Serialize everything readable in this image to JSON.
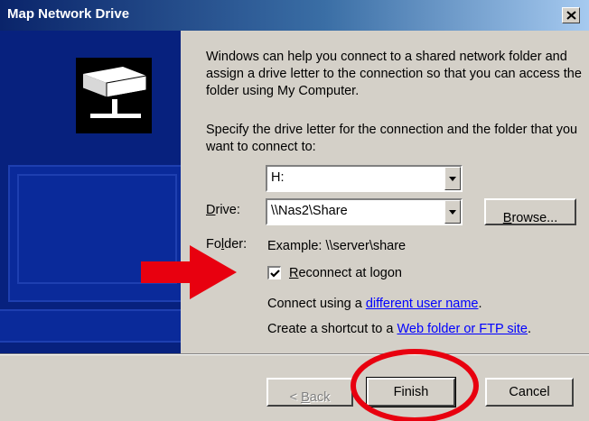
{
  "title": "Map Network Drive",
  "intro": "Windows can help you connect to a shared network folder and assign a drive letter to the connection so that you can access the folder using My Computer.",
  "instruction": "Specify the drive letter for the connection and the folder that you want to connect to:",
  "drive": {
    "label_key": "D",
    "label_rest": "rive:",
    "value": "H:"
  },
  "folder": {
    "label_pre": "Fo",
    "label_key": "l",
    "label_rest": "der:",
    "value": "\\\\Nas2\\Share"
  },
  "browse": {
    "key": "B",
    "rest": "rowse..."
  },
  "example": "Example: \\\\server\\share",
  "reconnect": {
    "key": "R",
    "rest": "econnect at logon",
    "checked": true
  },
  "connect_using": {
    "prefix": "Connect using a ",
    "link": "different user name",
    "suffix": "."
  },
  "shortcut": {
    "prefix": "Create a shortcut to a ",
    "link": "Web folder or FTP site",
    "suffix": "."
  },
  "buttons": {
    "back_pre": "< ",
    "back_key": "B",
    "back_rest": "ack",
    "finish": "Finish",
    "cancel": "Cancel"
  },
  "colors": {
    "annotation_red": "#e8000f",
    "side_panel": "#07217e"
  }
}
